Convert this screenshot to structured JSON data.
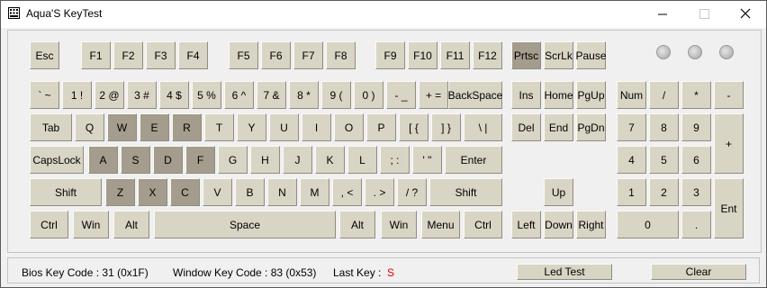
{
  "window": {
    "title": "Aqua'S KeyTest",
    "controls": {
      "minimize": "—",
      "maximize": "☐",
      "close": "✕"
    }
  },
  "keyboard": {
    "pressed_color": "#a49c8c",
    "key_color": "#d9d5c5",
    "keys": [
      {
        "id": "esc",
        "label": "Esc",
        "pressed": false
      },
      {
        "id": "f1",
        "label": "F1",
        "pressed": false
      },
      {
        "id": "f2",
        "label": "F2",
        "pressed": false
      },
      {
        "id": "f3",
        "label": "F3",
        "pressed": false
      },
      {
        "id": "f4",
        "label": "F4",
        "pressed": false
      },
      {
        "id": "f5",
        "label": "F5",
        "pressed": false
      },
      {
        "id": "f6",
        "label": "F6",
        "pressed": false
      },
      {
        "id": "f7",
        "label": "F7",
        "pressed": false
      },
      {
        "id": "f8",
        "label": "F8",
        "pressed": false
      },
      {
        "id": "f9",
        "label": "F9",
        "pressed": false
      },
      {
        "id": "f10",
        "label": "F10",
        "pressed": false
      },
      {
        "id": "f11",
        "label": "F11",
        "pressed": false
      },
      {
        "id": "f12",
        "label": "F12",
        "pressed": false
      },
      {
        "id": "prtsc",
        "label": "Prtsc",
        "pressed": true
      },
      {
        "id": "scrlk",
        "label": "ScrLk",
        "pressed": false
      },
      {
        "id": "pause",
        "label": "Pause",
        "pressed": false
      },
      {
        "id": "backtick",
        "label": "` ~",
        "pressed": false
      },
      {
        "id": "1",
        "label": "1 !",
        "pressed": false
      },
      {
        "id": "2",
        "label": "2 @",
        "pressed": false
      },
      {
        "id": "3",
        "label": "3 #",
        "pressed": false
      },
      {
        "id": "4",
        "label": "4 $",
        "pressed": false
      },
      {
        "id": "5",
        "label": "5 %",
        "pressed": false
      },
      {
        "id": "6",
        "label": "6 ^",
        "pressed": false
      },
      {
        "id": "7",
        "label": "7 &",
        "pressed": false
      },
      {
        "id": "8",
        "label": "8 *",
        "pressed": false
      },
      {
        "id": "9",
        "label": "9 (",
        "pressed": false
      },
      {
        "id": "0",
        "label": "0 )",
        "pressed": false
      },
      {
        "id": "minus",
        "label": "- _",
        "pressed": false
      },
      {
        "id": "equals",
        "label": "+ =",
        "pressed": false
      },
      {
        "id": "backspace",
        "label": "BackSpace",
        "pressed": false
      },
      {
        "id": "ins",
        "label": "Ins",
        "pressed": false
      },
      {
        "id": "home",
        "label": "Home",
        "pressed": false
      },
      {
        "id": "pgup",
        "label": "PgUp",
        "pressed": false
      },
      {
        "id": "num",
        "label": "Num",
        "pressed": false
      },
      {
        "id": "npdiv",
        "label": "/",
        "pressed": false
      },
      {
        "id": "npmul",
        "label": "*",
        "pressed": false
      },
      {
        "id": "npsub",
        "label": "-",
        "pressed": false
      },
      {
        "id": "tab",
        "label": "Tab",
        "pressed": false
      },
      {
        "id": "q",
        "label": "Q",
        "pressed": false
      },
      {
        "id": "w",
        "label": "W",
        "pressed": true
      },
      {
        "id": "e",
        "label": "E",
        "pressed": true
      },
      {
        "id": "r",
        "label": "R",
        "pressed": true
      },
      {
        "id": "t",
        "label": "T",
        "pressed": false
      },
      {
        "id": "y",
        "label": "Y",
        "pressed": false
      },
      {
        "id": "u",
        "label": "U",
        "pressed": false
      },
      {
        "id": "i",
        "label": "I",
        "pressed": false
      },
      {
        "id": "o",
        "label": "O",
        "pressed": false
      },
      {
        "id": "p",
        "label": "P",
        "pressed": false
      },
      {
        "id": "lbracket",
        "label": "[ {",
        "pressed": false
      },
      {
        "id": "rbracket",
        "label": "] }",
        "pressed": false
      },
      {
        "id": "backslash",
        "label": "\\ |",
        "pressed": false
      },
      {
        "id": "del",
        "label": "Del",
        "pressed": false
      },
      {
        "id": "end",
        "label": "End",
        "pressed": false
      },
      {
        "id": "pgdn",
        "label": "PgDn",
        "pressed": false
      },
      {
        "id": "np7",
        "label": "7",
        "pressed": false
      },
      {
        "id": "np8",
        "label": "8",
        "pressed": false
      },
      {
        "id": "np9",
        "label": "9",
        "pressed": false
      },
      {
        "id": "npadd",
        "label": "+",
        "pressed": false
      },
      {
        "id": "capslock",
        "label": "CapsLock",
        "pressed": false
      },
      {
        "id": "a",
        "label": "A",
        "pressed": true
      },
      {
        "id": "s",
        "label": "S",
        "pressed": true
      },
      {
        "id": "d",
        "label": "D",
        "pressed": true
      },
      {
        "id": "f",
        "label": "F",
        "pressed": true
      },
      {
        "id": "g",
        "label": "G",
        "pressed": false
      },
      {
        "id": "h",
        "label": "H",
        "pressed": false
      },
      {
        "id": "j",
        "label": "J",
        "pressed": false
      },
      {
        "id": "k",
        "label": "K",
        "pressed": false
      },
      {
        "id": "l",
        "label": "L",
        "pressed": false
      },
      {
        "id": "semicolon",
        "label": "; :",
        "pressed": false
      },
      {
        "id": "quote",
        "label": "' \"",
        "pressed": false
      },
      {
        "id": "enter",
        "label": "Enter",
        "pressed": false
      },
      {
        "id": "np4",
        "label": "4",
        "pressed": false
      },
      {
        "id": "np5",
        "label": "5",
        "pressed": false
      },
      {
        "id": "np6",
        "label": "6",
        "pressed": false
      },
      {
        "id": "lshift",
        "label": "Shift",
        "pressed": false
      },
      {
        "id": "z",
        "label": "Z",
        "pressed": true
      },
      {
        "id": "x",
        "label": "X",
        "pressed": true
      },
      {
        "id": "c",
        "label": "C",
        "pressed": true
      },
      {
        "id": "v",
        "label": "V",
        "pressed": false
      },
      {
        "id": "b",
        "label": "B",
        "pressed": false
      },
      {
        "id": "n",
        "label": "N",
        "pressed": false
      },
      {
        "id": "m",
        "label": "M",
        "pressed": false
      },
      {
        "id": "comma",
        "label": ", <",
        "pressed": false
      },
      {
        "id": "period",
        "label": ". >",
        "pressed": false
      },
      {
        "id": "slash",
        "label": "/ ?",
        "pressed": false
      },
      {
        "id": "rshift",
        "label": "Shift",
        "pressed": false
      },
      {
        "id": "up",
        "label": "Up",
        "pressed": false
      },
      {
        "id": "np1",
        "label": "1",
        "pressed": false
      },
      {
        "id": "np2",
        "label": "2",
        "pressed": false
      },
      {
        "id": "np3",
        "label": "3",
        "pressed": false
      },
      {
        "id": "npenter",
        "label": "Ent",
        "pressed": false
      },
      {
        "id": "lctrl",
        "label": "Ctrl",
        "pressed": false
      },
      {
        "id": "lwin",
        "label": "Win",
        "pressed": false
      },
      {
        "id": "lalt",
        "label": "Alt",
        "pressed": false
      },
      {
        "id": "space",
        "label": "Space",
        "pressed": false
      },
      {
        "id": "ralt",
        "label": "Alt",
        "pressed": false
      },
      {
        "id": "rwin",
        "label": "Win",
        "pressed": false
      },
      {
        "id": "menu",
        "label": "Menu",
        "pressed": false
      },
      {
        "id": "rctrl",
        "label": "Ctrl",
        "pressed": false
      },
      {
        "id": "left",
        "label": "Left",
        "pressed": false
      },
      {
        "id": "down",
        "label": "Down",
        "pressed": false
      },
      {
        "id": "right",
        "label": "Right",
        "pressed": false
      },
      {
        "id": "np0",
        "label": "0",
        "pressed": false
      },
      {
        "id": "npdot",
        "label": ".",
        "pressed": false
      }
    ]
  },
  "leds": [
    "off",
    "off",
    "off"
  ],
  "status": {
    "bios_label": "Bios Key Code :",
    "bios_value": "31 (0x1F)",
    "window_label": "Window Key Code :",
    "window_value": "83 (0x53)",
    "last_key_label": "Last Key :",
    "last_key_value": "S",
    "led_test": "Led Test",
    "clear": "Clear"
  }
}
